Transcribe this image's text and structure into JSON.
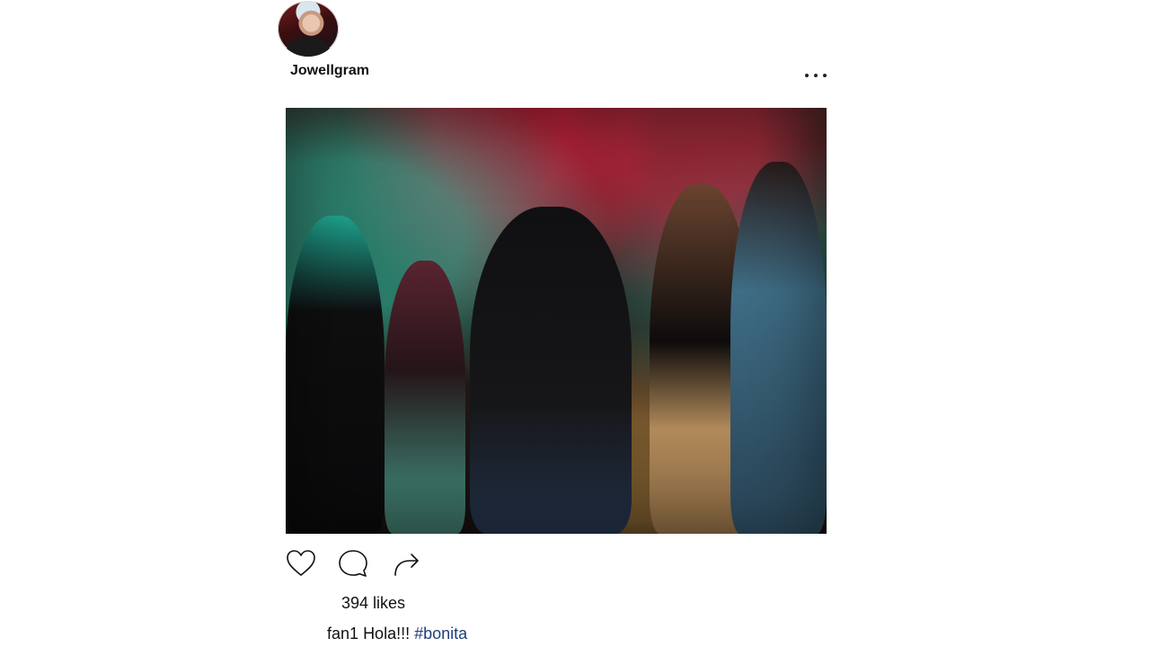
{
  "post": {
    "username": "Jowellgram",
    "more_icon": "more-horizontal-icon",
    "photo_description_icon": "photo",
    "actions": {
      "like_icon": "heart-icon",
      "comment_icon": "comment-icon",
      "share_icon": "share-arrow-icon"
    },
    "likes_text": "394 likes",
    "caption": {
      "author": "fan1",
      "text": "Hola!!!",
      "hashtag": "#bonita"
    }
  },
  "colors": {
    "background": "#ffffff",
    "text": "#111111",
    "hashtag": "#1f3f7a"
  }
}
